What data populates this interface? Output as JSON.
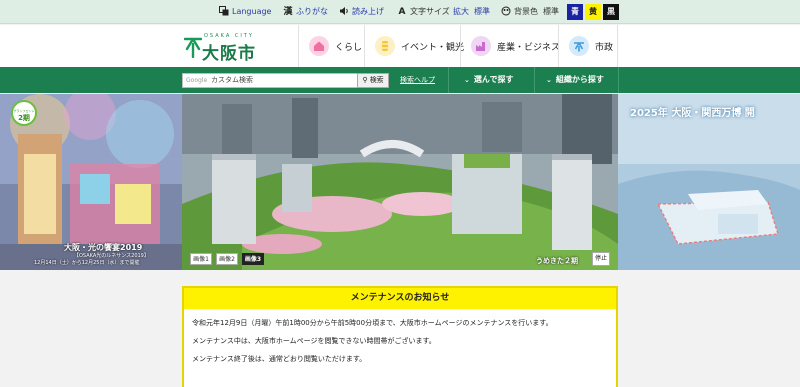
{
  "a11y_bar": {
    "language": "Language",
    "furigana": "ふりがな",
    "read_aloud": "読み上げ",
    "font_size_label": "文字サイズ",
    "enlarge": "拡大",
    "standard_size": "標準",
    "bg_color_label": "背景色",
    "standard_color": "標準",
    "blue": "青",
    "yellow": "黄",
    "black": "黒",
    "colors": {
      "bar": "#dfeee5",
      "blue_swatch": "#1a23a0",
      "yellow_swatch": "#fff200",
      "black_swatch": "#111111"
    }
  },
  "header": {
    "logo_sub": "OSAKA CITY",
    "logo_main": "大阪市",
    "menu": [
      {
        "label": "くらし",
        "icon": "house-icon",
        "color": "#f06ea0"
      },
      {
        "label": "イベント・観光",
        "icon": "lantern-icon",
        "color": "#f5c631"
      },
      {
        "label": "産業・ビジネス",
        "icon": "factory-icon",
        "color": "#c86ad0"
      },
      {
        "label": "市政",
        "icon": "city-hall-icon",
        "color": "#3b9be0"
      }
    ]
  },
  "nav": {
    "search_brand": "Google",
    "search_placeholder": "カスタム検索",
    "search_button": "検索",
    "search_help": "検索ヘルプ",
    "choose_btn": "選んで探す",
    "org_btn": "組織から探す",
    "color": "#1b7f4f"
  },
  "hero": {
    "left_caption_1": "大阪・光の饗宴2019",
    "left_caption_2": "【OSAKA光のルネサンス2019】",
    "left_caption_3": "12月14日（土）から12月25日（水）まで開催",
    "right_caption": "2025年 大阪・関西万博 開",
    "badge_line1": "グランフロント",
    "badge_line2": "2期",
    "phase_caption": "うめきた２期",
    "stop_label": "停止",
    "thumbs": [
      "画像1",
      "画像2",
      "画像3"
    ],
    "active_thumb": 3
  },
  "notice": {
    "title": "メンテナンスのお知らせ",
    "line1": "令和元年12月9日（月曜）午前1時00分から午前5時00分頃まで、大阪市ホームページのメンテナンスを行います。",
    "line2": "メンテナンス中は、大阪市ホームページを閲覧できない時間帯がございます。",
    "line3": "メンテナンス終了後は、通常どおり閲覧いただけます。",
    "colors": {
      "title_bg": "#fff200",
      "border": "#e6d400"
    }
  }
}
